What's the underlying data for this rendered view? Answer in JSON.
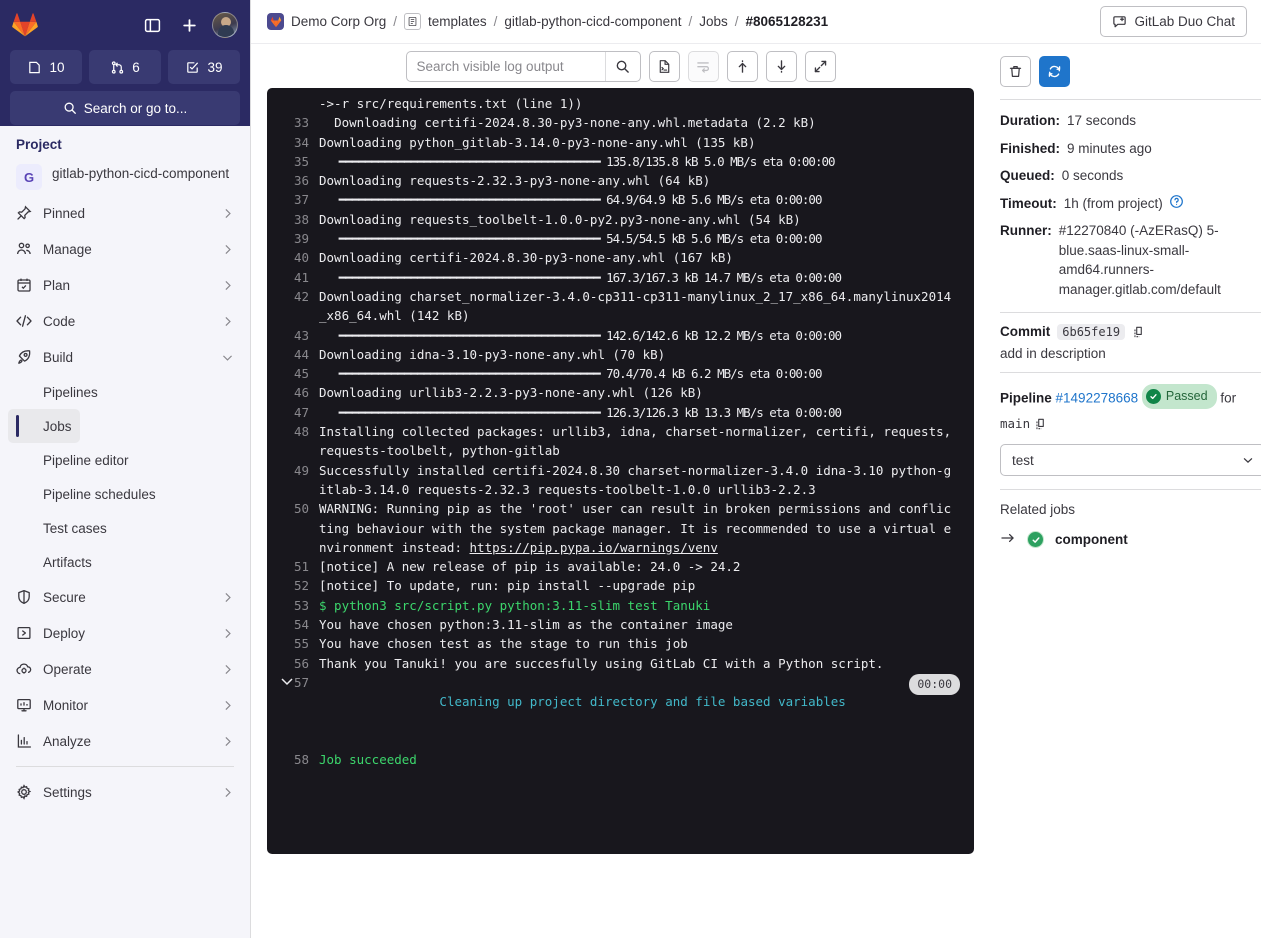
{
  "sidebar": {
    "counts": [
      {
        "icon": "issues-icon",
        "value": "10",
        "name": "issues-count"
      },
      {
        "icon": "merge-request-icon",
        "value": "6",
        "name": "merge-requests-count"
      },
      {
        "icon": "todo-icon",
        "value": "39",
        "name": "todos-count"
      }
    ],
    "search_label": "Search or go to...",
    "section_title": "Project",
    "project": {
      "initial": "G",
      "name": "gitlab-python-cicd-component"
    },
    "nav": [
      {
        "label": "Pinned",
        "icon": "pin-icon",
        "expandable": true
      },
      {
        "label": "Manage",
        "icon": "users-icon",
        "expandable": true
      },
      {
        "label": "Plan",
        "icon": "calendar-icon",
        "expandable": true
      },
      {
        "label": "Code",
        "icon": "code-icon",
        "expandable": true
      },
      {
        "label": "Build",
        "icon": "rocket-icon",
        "expandable": true,
        "expanded": true
      }
    ],
    "build_subitems": [
      {
        "label": "Pipelines",
        "active": false
      },
      {
        "label": "Jobs",
        "active": true
      },
      {
        "label": "Pipeline editor",
        "active": false
      },
      {
        "label": "Pipeline schedules",
        "active": false
      },
      {
        "label": "Test cases",
        "active": false
      },
      {
        "label": "Artifacts",
        "active": false
      }
    ],
    "nav_lower": [
      {
        "label": "Secure",
        "icon": "shield-icon",
        "expandable": true
      },
      {
        "label": "Deploy",
        "icon": "deploy-icon",
        "expandable": true
      },
      {
        "label": "Operate",
        "icon": "cloud-gear-icon",
        "expandable": true
      },
      {
        "label": "Monitor",
        "icon": "monitor-icon",
        "expandable": true
      },
      {
        "label": "Analyze",
        "icon": "chart-icon",
        "expandable": true
      }
    ],
    "nav_settings": [
      {
        "label": "Settings",
        "icon": "gear-icon",
        "expandable": true
      }
    ]
  },
  "topbar": {
    "breadcrumbs": [
      {
        "label": "Demo Corp Org",
        "icon": "org-avatar",
        "current": false
      },
      {
        "label": "templates",
        "icon": "group-avatar",
        "current": false
      },
      {
        "label": "gitlab-python-cicd-component",
        "current": false
      },
      {
        "label": "Jobs",
        "current": false
      },
      {
        "label": "#8065128231",
        "current": true
      }
    ],
    "separator": "/",
    "duo_button": "GitLab Duo Chat"
  },
  "log_toolbar": {
    "search_placeholder": "Search visible log output",
    "search_value": "",
    "buttons": [
      {
        "name": "raw-log-button",
        "icon": "file-icon",
        "disabled": false
      },
      {
        "name": "soft-wrap-button",
        "icon": "wrap-icon",
        "disabled": true
      },
      {
        "name": "scroll-to-top-button",
        "icon": "arrow-up-icon",
        "disabled": false
      },
      {
        "name": "scroll-to-bottom-button",
        "icon": "arrow-down-icon",
        "disabled": false
      },
      {
        "name": "full-screen-button",
        "icon": "expand-icon",
        "disabled": false
      }
    ]
  },
  "log": {
    "partial_top": "->-r src/requirements.txt (line 1))",
    "lines": [
      {
        "num": "33",
        "text": "  Downloading certifi-2024.8.30-py3-none-any.whl.metadata (2.2 kB)",
        "color": "white"
      },
      {
        "num": "34",
        "text": "Downloading python_gitlab-3.14.0-py3-none-any.whl (135 kB)",
        "color": "white"
      },
      {
        "num": "35",
        "text": "   ━━━━━━━━━━━━━━━━━━━━━━━━━━━━━━━━━━━━━━━━ 135.8/135.8 kB 5.0 MB/s eta 0:00:00",
        "color": "white"
      },
      {
        "num": "36",
        "text": "Downloading requests-2.32.3-py3-none-any.whl (64 kB)",
        "color": "white"
      },
      {
        "num": "37",
        "text": "   ━━━━━━━━━━━━━━━━━━━━━━━━━━━━━━━━━━━━━━━━ 64.9/64.9 kB 5.6 MB/s eta 0:00:00",
        "color": "white"
      },
      {
        "num": "38",
        "text": "Downloading requests_toolbelt-1.0.0-py2.py3-none-any.whl (54 kB)",
        "color": "white"
      },
      {
        "num": "39",
        "text": "   ━━━━━━━━━━━━━━━━━━━━━━━━━━━━━━━━━━━━━━━━ 54.5/54.5 kB 5.6 MB/s eta 0:00:00",
        "color": "white"
      },
      {
        "num": "40",
        "text": "Downloading certifi-2024.8.30-py3-none-any.whl (167 kB)",
        "color": "white"
      },
      {
        "num": "41",
        "text": "   ━━━━━━━━━━━━━━━━━━━━━━━━━━━━━━━━━━━━━━━━ 167.3/167.3 kB 14.7 MB/s eta 0:00:00",
        "color": "white"
      },
      {
        "num": "42",
        "text": "Downloading charset_normalizer-3.4.0-cp311-cp311-manylinux_2_17_x86_64.manylinux2014_x86_64.whl (142 kB)",
        "color": "white"
      },
      {
        "num": "43",
        "text": "   ━━━━━━━━━━━━━━━━━━━━━━━━━━━━━━━━━━━━━━━━ 142.6/142.6 kB 12.2 MB/s eta 0:00:00",
        "color": "white"
      },
      {
        "num": "44",
        "text": "Downloading idna-3.10-py3-none-any.whl (70 kB)",
        "color": "white"
      },
      {
        "num": "45",
        "text": "   ━━━━━━━━━━━━━━━━━━━━━━━━━━━━━━━━━━━━━━━━ 70.4/70.4 kB 6.2 MB/s eta 0:00:00",
        "color": "white"
      },
      {
        "num": "46",
        "text": "Downloading urllib3-2.2.3-py3-none-any.whl (126 kB)",
        "color": "white"
      },
      {
        "num": "47",
        "text": "   ━━━━━━━━━━━━━━━━━━━━━━━━━━━━━━━━━━━━━━━━ 126.3/126.3 kB 13.3 MB/s eta 0:00:00",
        "color": "white"
      },
      {
        "num": "48",
        "text": "Installing collected packages: urllib3, idna, charset-normalizer, certifi, requests, requests-toolbelt, python-gitlab",
        "color": "white"
      },
      {
        "num": "49",
        "text": "Successfully installed certifi-2024.8.30 charset-normalizer-3.4.0 idna-3.10 python-gitlab-3.14.0 requests-2.32.3 requests-toolbelt-1.0.0 urllib3-2.2.3",
        "color": "white"
      },
      {
        "num": "50",
        "text": "WARNING: Running pip as the 'root' user can result in broken permissions and conflicting behaviour with the system package manager. It is recommended to use a virtual environment instead: ",
        "color": "white",
        "link": "https://pip.pypa.io/warnings/venv"
      },
      {
        "num": "51",
        "text": "[notice] A new release of pip is available: 24.0 -> 24.2",
        "color": "white"
      },
      {
        "num": "52",
        "text": "[notice] To update, run: pip install --upgrade pip",
        "color": "white"
      },
      {
        "num": "53",
        "text": "$ python3 src/script.py python:3.11-slim test Tanuki",
        "color": "green"
      },
      {
        "num": "54",
        "text": "You have chosen python:3.11-slim as the container image",
        "color": "white"
      },
      {
        "num": "55",
        "text": "You have chosen test as the stage to run this job",
        "color": "white"
      },
      {
        "num": "56",
        "text": "Thank you Tanuki! you are succesfully using GitLab CI with a Python script.",
        "color": "white"
      },
      {
        "num": "57",
        "text": "Cleaning up project directory and file based variables",
        "color": "cyan",
        "collapsible": true,
        "duration": "00:00"
      },
      {
        "num": "58",
        "text": "Job succeeded",
        "color": "green"
      }
    ]
  },
  "right_panel": {
    "actions": [
      {
        "name": "erase-job-log-button",
        "icon": "trash-icon"
      },
      {
        "name": "retry-job-button",
        "icon": "retry-icon"
      }
    ],
    "details": [
      {
        "key": "Duration:",
        "value": "17 seconds"
      },
      {
        "key": "Finished:",
        "value": "9 minutes ago"
      },
      {
        "key": "Queued:",
        "value": "0 seconds"
      },
      {
        "key": "Timeout:",
        "value": "1h (from project)",
        "help": true
      },
      {
        "key": "Runner:",
        "value": "#12270840 (-AzERasQ) 5-blue.saas-linux-small-amd64.runners-manager.gitlab.com/default"
      }
    ],
    "commit": {
      "label": "Commit",
      "sha": "6b65fe19",
      "title": "add in description"
    },
    "pipeline": {
      "label": "Pipeline",
      "id": "#1492278668",
      "status": "Passed",
      "for_word": "for",
      "ref": "main"
    },
    "stage_select": {
      "value": "test"
    },
    "related_jobs": {
      "title": "Related jobs",
      "items": [
        {
          "name": "component",
          "status": "passed"
        }
      ]
    }
  },
  "colors": {
    "brand_navy": "#2b2a63",
    "accent_blue": "#1f75cb",
    "success_green": "#108548",
    "log_bg": "#18171d",
    "log_green": "#3cd66c",
    "log_cyan": "#42b8c9"
  }
}
